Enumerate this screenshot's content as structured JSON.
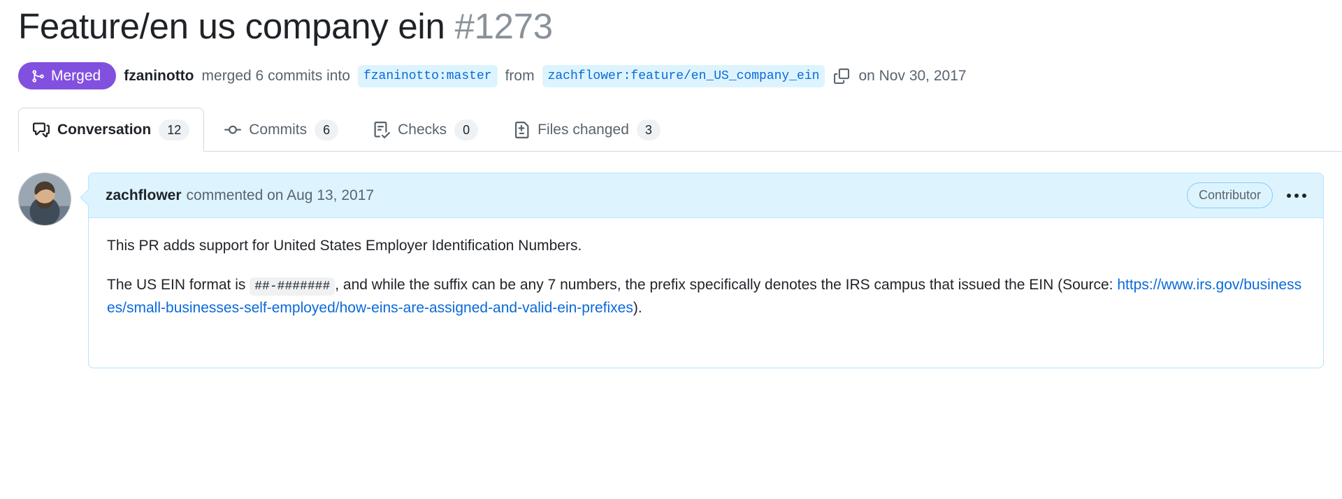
{
  "header": {
    "title": "Feature/en us company ein",
    "number": "#1273"
  },
  "status": {
    "badge_label": "Merged",
    "badge_icon": "git-merge-icon",
    "badge_color": "#8250df",
    "author": "fzaninotto",
    "text_merged": "merged 6 commits into",
    "base_branch": "fzaninotto:master",
    "text_from": "from",
    "head_branch": "zachflower:feature/en_US_company_ein",
    "copy_icon": "copy-icon",
    "date": "on Nov 30, 2017"
  },
  "tabs": [
    {
      "label": "Conversation",
      "count": "12",
      "icon": "comment-discussion-icon",
      "active": true
    },
    {
      "label": "Commits",
      "count": "6",
      "icon": "git-commit-icon",
      "active": false
    },
    {
      "label": "Checks",
      "count": "0",
      "icon": "checklist-icon",
      "active": false
    },
    {
      "label": "Files changed",
      "count": "3",
      "icon": "file-diff-icon",
      "active": false
    }
  ],
  "comment": {
    "avatar_name": "zachflower-avatar",
    "author": "zachflower",
    "meta": "commented on Aug 13, 2017",
    "badge": "Contributor",
    "menu_icon": "kebab-menu-icon",
    "paragraph1": "This PR adds support for United States Employer Identification Numbers.",
    "p2_before_code": "The US EIN format is",
    "code": "##-#######",
    "p2_after_code": ", and while the suffix can be any 7 numbers, the prefix specifically denotes the IRS campus that issued the EIN (Source:",
    "link_text": "https://www.irs.gov/businesses/small-businesses-self-employed/how-eins-are-assigned-and-valid-ein-prefixes",
    "p2_tail": ")."
  },
  "colors": {
    "merged_purple": "#8250df",
    "branch_blue_bg": "#ddf4ff",
    "branch_blue_text": "#0969da",
    "link_blue": "#0969da",
    "border": "#d1d9e0",
    "comment_header_bg": "#ddf4ff",
    "comment_border": "#b6e3ff",
    "muted_text": "#59636e"
  }
}
